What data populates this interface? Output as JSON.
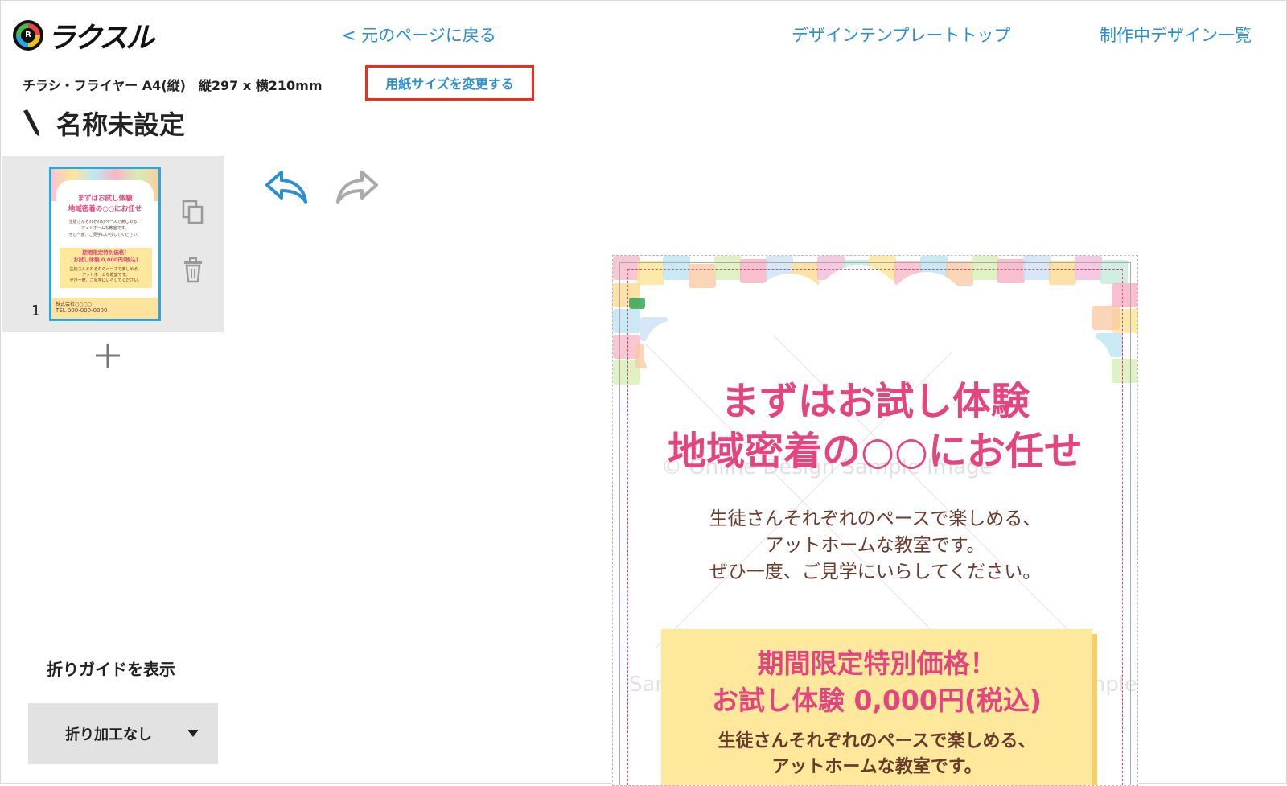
{
  "header": {
    "logo_text": "ラクスル",
    "back_link": "< 元のページに戻る",
    "template_top_link": "デザインテンプレートトップ",
    "in_progress_link": "制作中デザイン一覧"
  },
  "paper": {
    "info": "チラシ・フライヤー A4(縦)　縦297 x 横210mm",
    "change_size_label": "用紙サイズを変更する"
  },
  "design": {
    "title": "名称未設定"
  },
  "pages": {
    "items": [
      {
        "number": "1"
      }
    ]
  },
  "thumbnail": {
    "line1": "まずはお試し体験",
    "line2": "地域密着の○○にお任せ",
    "p1": "生徒さんそれぞれのペースで楽しめる、",
    "p2": "アットホームな教室です。",
    "p3": "ぜひ一度、ご見学にいらしてください。",
    "box1": "期間限定特別価格！",
    "box2": "お試し体験 0,000円(税込)",
    "box3": "生徒さんそれぞれのペースで楽しめる、",
    "box4": "アットホームな教室です。",
    "box5": "ぜひ一度、ご見学にいらしてください。",
    "company": "株式会社○○○○",
    "tel": "TEL 000-000-0000"
  },
  "fold": {
    "label": "折りガイドを表示",
    "selected": "折り加工なし"
  },
  "flyer": {
    "headline1": "まずはお試し体験",
    "headline2": "地域密着の○○にお任せ",
    "body1": "生徒さんそれぞれのペースで楽しめる、",
    "body2": "アットホームな教室です。",
    "body3": "ぜひ一度、ご見学にいらしてください。",
    "price_title": "期間限定特別価格！",
    "price_value": "お試し体験 0,000円(税込)",
    "price_body1": "生徒さんそれぞれのペースで楽しめる、",
    "price_body2": "アットホームな教室です。",
    "watermark1": "© Online Design Sample Image",
    "watermark2": "Sample Image",
    "watermark3": "© Online Design Sample"
  },
  "colors": {
    "link": "#2a8fd0",
    "highlight": "#f02d18",
    "accent_pink": "#e4457f",
    "selected_border": "#2aa6e0",
    "panel_bg": "#e8e8e8"
  }
}
